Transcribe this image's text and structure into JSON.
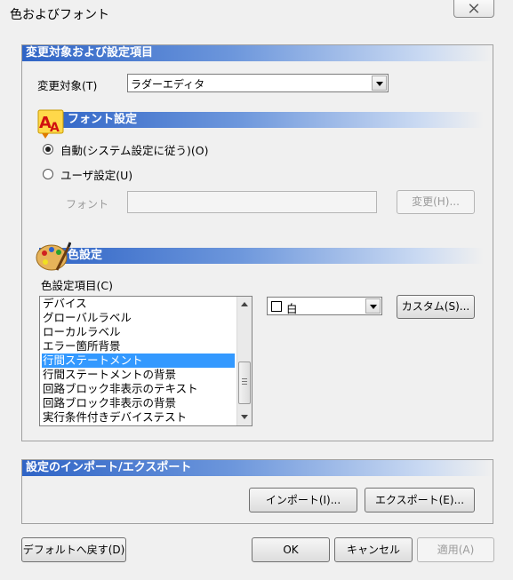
{
  "window": {
    "title": "色およびフォント",
    "close_icon": "close-icon"
  },
  "target_section": {
    "header": "変更対象および設定項目",
    "target_label": "変更対象(T)",
    "target_value": "ラダーエディタ"
  },
  "font_section": {
    "header": "フォント設定",
    "icon": "font-aa-icon",
    "auto_option": "自動(システム設定に従う)(O)",
    "user_option": "ユーザ設定(U)",
    "font_label": "フォント",
    "font_value": "",
    "change_button": "変更(H)...",
    "selected": "auto"
  },
  "color_section": {
    "header": "色設定",
    "icon": "palette-icon",
    "items_label": "色設定項目(C)",
    "items": [
      "デバイス",
      "グローバルラベル",
      "ローカルラベル",
      "エラー箇所背景",
      "行間ステートメント",
      "行間ステートメントの背景",
      "回路ブロック非表示のテキスト",
      "回路ブロック非表示の背景",
      "実行条件付きデバイステスト"
    ],
    "selected_item": "行間ステートメント",
    "color_value": "白",
    "color_swatch": "#ffffff",
    "custom_button": "カスタム(S)..."
  },
  "import_export_section": {
    "header": "設定のインポート/エクスポート",
    "import_button": "インポート(I)...",
    "export_button": "エクスポート(E)..."
  },
  "footer": {
    "default_button": "デフォルトへ戻す(D)",
    "ok_button": "OK",
    "cancel_button": "キャンセル",
    "apply_button": "適用(A)"
  },
  "colors": {
    "section_accent": "#2f64c6",
    "selection": "#3399ff"
  }
}
